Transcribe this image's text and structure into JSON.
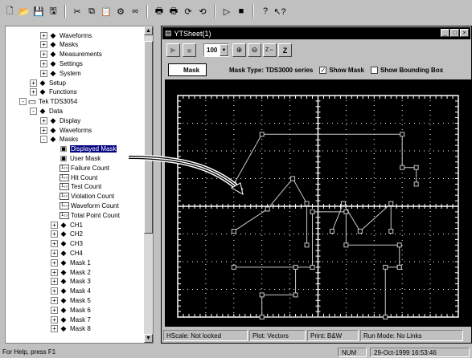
{
  "toolbar": {
    "buttons": [
      "new-icon",
      "open-icon",
      "save-icon",
      "save-as-icon",
      "cut-icon",
      "copy-icon",
      "paste-icon",
      "connect-icon",
      "link-icon",
      "print-icon",
      "print-preview-icon",
      "refresh-icon",
      "refresh-all-icon",
      "run-icon",
      "stop-icon",
      "help-icon",
      "context-help-icon"
    ]
  },
  "tree": {
    "rows": [
      {
        "label": "Waveforms",
        "indent": 3,
        "expander": "+",
        "icon": "diamond"
      },
      {
        "label": "Masks",
        "indent": 3,
        "expander": "+",
        "icon": "diamond"
      },
      {
        "label": "Measurements",
        "indent": 3,
        "expander": "+",
        "icon": "diamond"
      },
      {
        "label": "Settings",
        "indent": 3,
        "expander": "+",
        "icon": "diamond"
      },
      {
        "label": "System",
        "indent": 3,
        "expander": "+",
        "icon": "diamond"
      },
      {
        "label": "Setup",
        "indent": 2,
        "expander": "+",
        "icon": "diamond"
      },
      {
        "label": "Functions",
        "indent": 2,
        "expander": "+",
        "icon": "diamond"
      },
      {
        "label": "Tek TDS3054",
        "indent": 1,
        "expander": "-",
        "icon": "scope"
      },
      {
        "label": "Data",
        "indent": 2,
        "expander": "-",
        "icon": "diamond"
      },
      {
        "label": "Display",
        "indent": 3,
        "expander": "+",
        "icon": "diamond"
      },
      {
        "label": "Waveforms",
        "indent": 3,
        "expander": "+",
        "icon": "diamond"
      },
      {
        "label": "Masks",
        "indent": 3,
        "expander": "-",
        "icon": "diamond"
      },
      {
        "label": "Displayed Mask",
        "indent": 4,
        "expander": "",
        "icon": "mask",
        "selected": true
      },
      {
        "label": "User Mask",
        "indent": 4,
        "expander": "",
        "icon": "mask"
      },
      {
        "label": "Failure Count",
        "indent": 4,
        "expander": "",
        "icon": "val"
      },
      {
        "label": "Hit Count",
        "indent": 4,
        "expander": "",
        "icon": "val"
      },
      {
        "label": "Test Count",
        "indent": 4,
        "expander": "",
        "icon": "val"
      },
      {
        "label": "Violation Count",
        "indent": 4,
        "expander": "",
        "icon": "val"
      },
      {
        "label": "Waveform Count",
        "indent": 4,
        "expander": "",
        "icon": "val"
      },
      {
        "label": "Total Point Count",
        "indent": 4,
        "expander": "",
        "icon": "val"
      },
      {
        "label": "CH1",
        "indent": 4,
        "expander": "+",
        "icon": "diamond"
      },
      {
        "label": "CH2",
        "indent": 4,
        "expander": "+",
        "icon": "diamond"
      },
      {
        "label": "CH3",
        "indent": 4,
        "expander": "+",
        "icon": "diamond"
      },
      {
        "label": "CH4",
        "indent": 4,
        "expander": "+",
        "icon": "diamond"
      },
      {
        "label": "Mask 1",
        "indent": 4,
        "expander": "+",
        "icon": "diamond"
      },
      {
        "label": "Mask 2",
        "indent": 4,
        "expander": "+",
        "icon": "diamond"
      },
      {
        "label": "Mask 3",
        "indent": 4,
        "expander": "+",
        "icon": "diamond"
      },
      {
        "label": "Mask 4",
        "indent": 4,
        "expander": "+",
        "icon": "diamond"
      },
      {
        "label": "Mask 5",
        "indent": 4,
        "expander": "+",
        "icon": "diamond"
      },
      {
        "label": "Mask 6",
        "indent": 4,
        "expander": "+",
        "icon": "diamond"
      },
      {
        "label": "Mask 7",
        "indent": 4,
        "expander": "+",
        "icon": "diamond"
      },
      {
        "label": "Mask 8",
        "indent": 4,
        "expander": "+",
        "icon": "diamond"
      }
    ],
    "value_icon_text": "1₂₃"
  },
  "graph_window": {
    "title": "YTSheet(1)",
    "zoom_value": "100",
    "mask_name": "Mask",
    "mask_type": "Mask Type: TDS3000 series",
    "show_mask_label": "Show Mask",
    "show_mask_checked": true,
    "show_bbox_label": "Show Bounding Box",
    "show_bbox_checked": false,
    "status": {
      "hscale": "HScale: Not locked",
      "plot": "Plot: Vectors",
      "print": "Print: B&W",
      "run_mode": "Run Mode: No Links"
    }
  },
  "app_status": {
    "help": "For Help, press F1",
    "num": "NUM",
    "datetime": "29-Oct-1999 16:53:46"
  },
  "colors": {
    "plot_bg": "#000000",
    "trace": "#c8c8c8",
    "grid": "#ffffff",
    "selection": "#000080"
  },
  "mask_segments": {
    "mask1": [
      [
        -3,
        -2.2
      ],
      [
        -0.2,
        -2.2
      ],
      [
        -0.2,
        -0.2
      ],
      [
        1,
        -0.2
      ],
      [
        1,
        -1.4
      ],
      [
        2.9,
        -1.4
      ],
      [
        2.9,
        -2.2
      ],
      [
        2.9,
        -2.2
      ],
      [
        2.4,
        -2.2
      ],
      [
        2.4,
        -4
      ],
      [
        -2,
        -4
      ],
      [
        -2,
        -3.2
      ],
      [
        -0.8,
        -3.2
      ],
      [
        -0.8,
        -2.2
      ]
    ],
    "top_trace": [
      [
        -3,
        0.8
      ],
      [
        -2,
        2.6
      ],
      [
        3,
        2.6
      ],
      [
        3,
        1.4
      ],
      [
        3.5,
        1.4
      ],
      [
        3.5,
        0.8
      ]
    ],
    "left_shape": [
      [
        -3,
        -0.9
      ],
      [
        -1.8,
        -0.1
      ],
      [
        -0.9,
        1
      ],
      [
        -0.4,
        0.1
      ],
      [
        -0.4,
        -1.4
      ]
    ],
    "right_shape": [
      [
        0.5,
        -0.9
      ],
      [
        0.9,
        0.1
      ],
      [
        1.5,
        -0.9
      ],
      [
        2.6,
        0.1
      ],
      [
        2.6,
        -0.9
      ]
    ]
  }
}
